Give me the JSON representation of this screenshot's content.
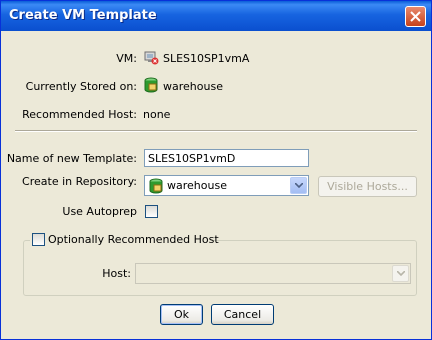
{
  "window": {
    "title": "Create VM Template",
    "close_label": "close"
  },
  "info": {
    "vm_label": "VM:",
    "vm_value": "SLES10SP1vmA",
    "stored_label": "Currently Stored on:",
    "stored_value": "warehouse",
    "recommended_label": "Recommended Host:",
    "recommended_value": "none"
  },
  "form": {
    "name_label": "Name of new Template:",
    "name_value": "SLES10SP1vmD",
    "repo_label": "Create in Repository:",
    "repo_value": "warehouse",
    "visible_hosts_label": "Visible Hosts...",
    "autoprep_label": "Use Autoprep",
    "autoprep_checked": false
  },
  "group": {
    "title": "Optionally Recommended Host",
    "checked": false,
    "host_label": "Host:",
    "host_value": ""
  },
  "buttons": {
    "ok_label": "Ok",
    "cancel_label": "Cancel"
  },
  "colors": {
    "titlebar": "#0a5dd8",
    "dialog_bg": "#ece9d8",
    "field_border": "#7f9db9",
    "repo_icon": "#2e9b2e"
  }
}
